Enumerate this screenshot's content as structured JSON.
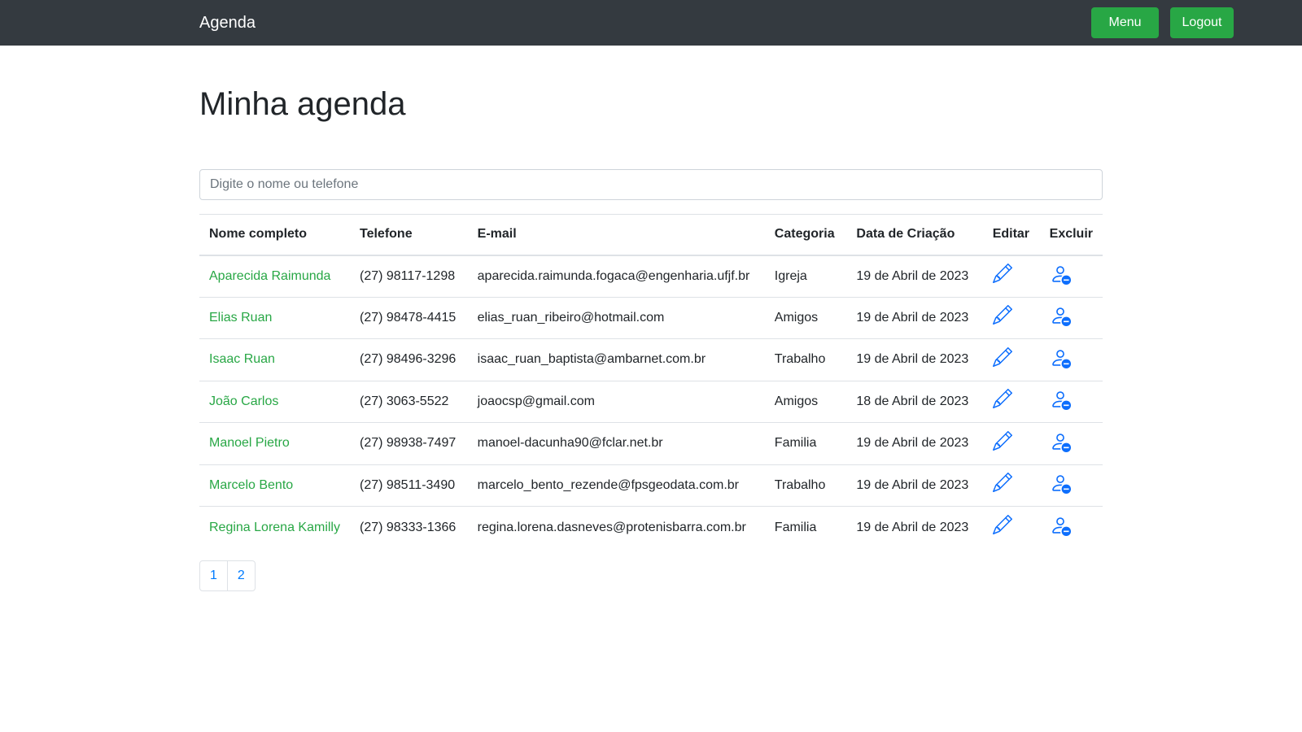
{
  "navbar": {
    "brand": "Agenda",
    "menu_label": "Menu",
    "logout_label": "Logout"
  },
  "page": {
    "title": "Minha agenda"
  },
  "search": {
    "placeholder": "Digite o nome ou telefone",
    "value": ""
  },
  "table": {
    "headers": [
      "Nome completo",
      "Telefone",
      "E-mail",
      "Categoria",
      "Data de Criação",
      "Editar",
      "Excluir"
    ],
    "rows": [
      {
        "name": "Aparecida Raimunda",
        "phone": "(27) 98117-1298",
        "email": "aparecida.raimunda.fogaca@engenharia.ufjf.br",
        "category": "Igreja",
        "created": "19 de Abril de 2023"
      },
      {
        "name": "Elias Ruan",
        "phone": "(27) 98478-4415",
        "email": "elias_ruan_ribeiro@hotmail.com",
        "category": "Amigos",
        "created": "19 de Abril de 2023"
      },
      {
        "name": "Isaac Ruan",
        "phone": "(27) 98496-3296",
        "email": "isaac_ruan_baptista@ambarnet.com.br",
        "category": "Trabalho",
        "created": "19 de Abril de 2023"
      },
      {
        "name": "João Carlos",
        "phone": "(27) 3063-5522",
        "email": "joaocsp@gmail.com",
        "category": "Amigos",
        "created": "18 de Abril de 2023"
      },
      {
        "name": "Manoel Pietro",
        "phone": "(27) 98938-7497",
        "email": "manoel-dacunha90@fclar.net.br",
        "category": "Familia",
        "created": "19 de Abril de 2023"
      },
      {
        "name": "Marcelo Bento",
        "phone": "(27) 98511-3490",
        "email": "marcelo_bento_rezende@fpsgeodata.com.br",
        "category": "Trabalho",
        "created": "19 de Abril de 2023"
      },
      {
        "name": "Regina Lorena Kamilly",
        "phone": "(27) 98333-1366",
        "email": "regina.lorena.dasneves@protenisbarra.com.br",
        "category": "Familia",
        "created": "19 de Abril de 2023"
      }
    ],
    "icons": {
      "edit": "pencil-icon",
      "delete": "person-dash-icon"
    }
  },
  "pagination": {
    "pages": [
      "1",
      "2"
    ]
  },
  "colors": {
    "navbar_bg": "#343a40",
    "accent_green": "#28a745",
    "link_blue": "#007bff",
    "icon_blue": "#0d6efd"
  }
}
